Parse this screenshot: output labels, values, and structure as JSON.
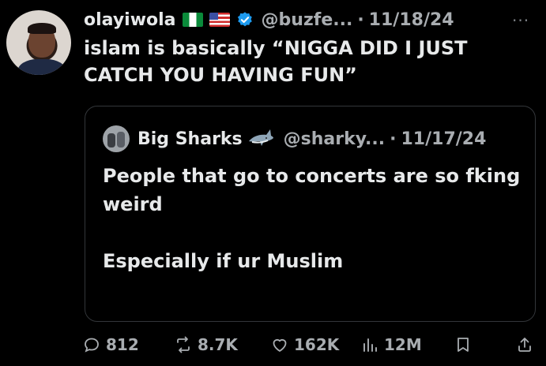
{
  "tweet": {
    "author_name": "olayiwola",
    "flags": [
      "nigeria-flag",
      "usa-flag"
    ],
    "handle": "@buzfe...",
    "separator": "·",
    "date": "11/18/24",
    "more": "···",
    "text_lines": [
      "islam is basically “NIGGA DID I JUST",
      "CATCH YOU HAVING FUN”"
    ]
  },
  "quote": {
    "author_name": "Big Sharks",
    "emoji": "shark-icon",
    "handle": "@sharky...",
    "separator": "·",
    "date": "11/17/24",
    "text_lines": [
      "People that go to concerts are so fking",
      "weird"
    ],
    "text_line2": "Especially if ur Muslim"
  },
  "actions": {
    "replies": "812",
    "reposts": "8.7K",
    "likes": "162K",
    "views": "12M"
  },
  "colors": {
    "background": "#000000",
    "text": "#e7e9ea",
    "muted": "#a9adb1",
    "verified": "#1d9bf0",
    "border": "#33363a"
  }
}
